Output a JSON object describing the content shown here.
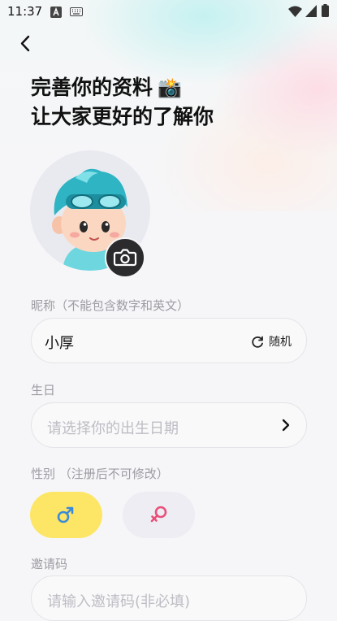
{
  "status_bar": {
    "time": "11:37"
  },
  "title": {
    "line1": "完善你的资料",
    "line2": "让大家更好的了解你",
    "emoji": "📸"
  },
  "nickname": {
    "label": "昵称（不能包含数字和英文）",
    "value": "小厚",
    "random_label": "随机"
  },
  "birthday": {
    "label": "生日",
    "placeholder": "请选择你的出生日期"
  },
  "gender": {
    "label": "性别 （注册后不可修改）",
    "options": [
      "male",
      "female"
    ],
    "selected": "male"
  },
  "invite": {
    "label": "邀请码",
    "placeholder": "请输入邀请码(非必填)"
  },
  "colors": {
    "selected_gender_bg": "#fde666",
    "male_symbol": "#3b8ad9",
    "female_symbol": "#e8507a"
  }
}
